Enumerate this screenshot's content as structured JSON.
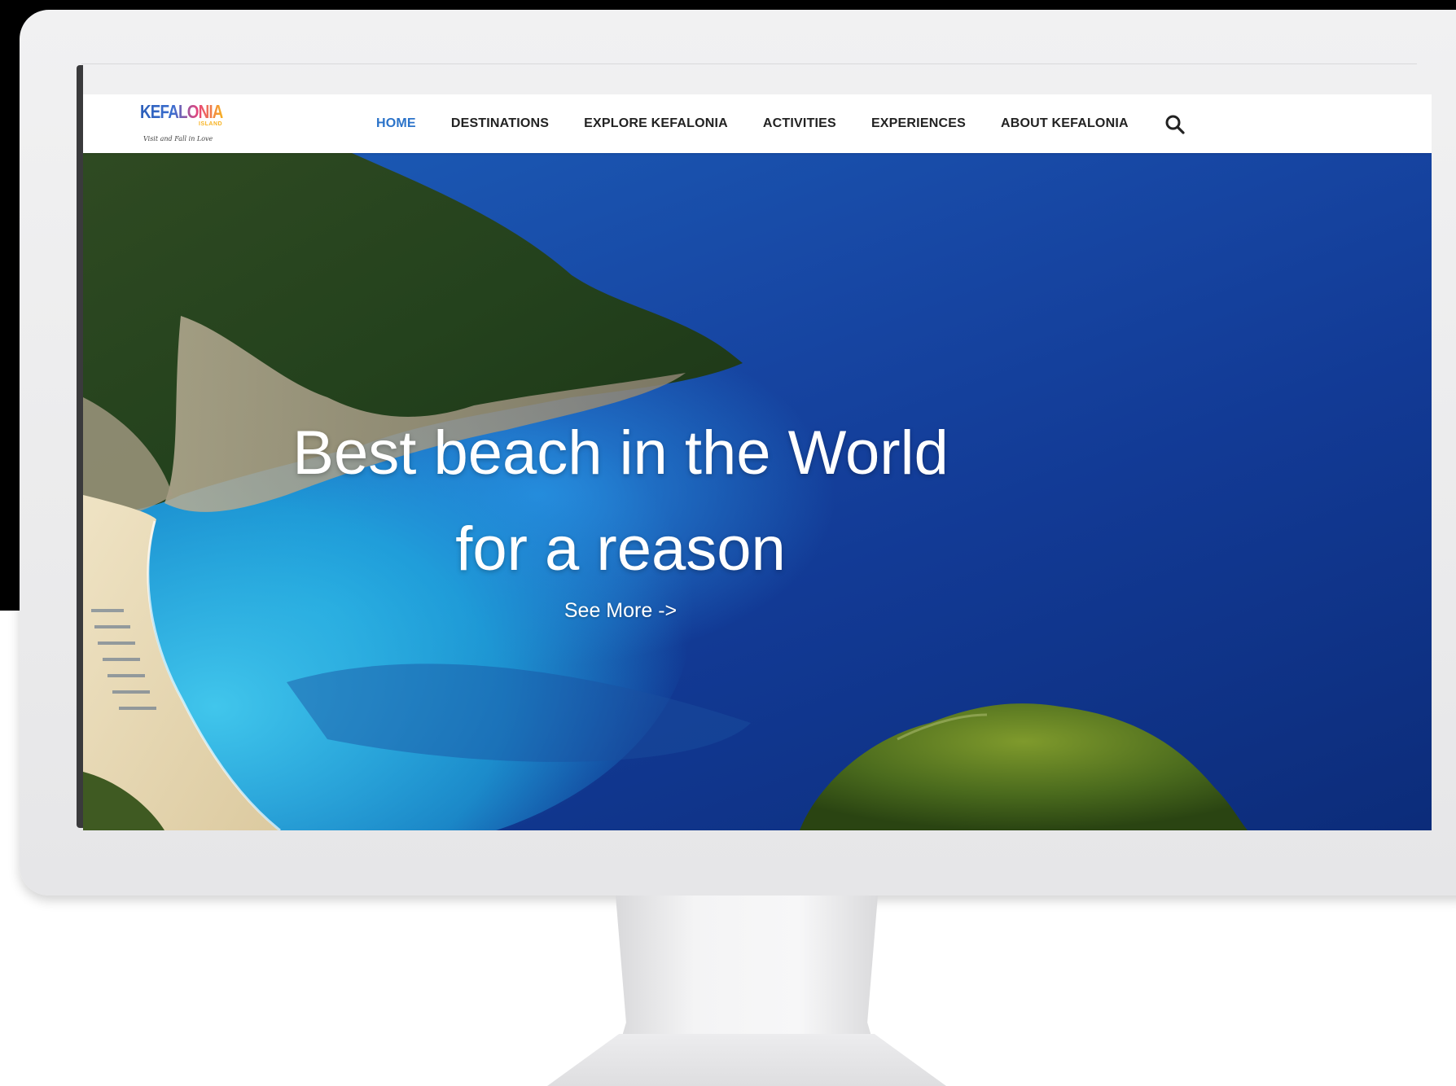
{
  "brand": {
    "name": "KEFALONIA",
    "sub": "ISLAND",
    "tagline": "Visit and Fall in Love"
  },
  "nav": {
    "items": [
      {
        "label": "HOME",
        "active": true
      },
      {
        "label": "DESTINATIONS",
        "active": false
      },
      {
        "label": "EXPLORE KEFALONIA",
        "active": false
      },
      {
        "label": "ACTIVITIES",
        "active": false
      },
      {
        "label": "EXPERIENCES",
        "active": false
      },
      {
        "label": "ABOUT KEFALONIA",
        "active": false
      }
    ],
    "search_icon": "search-icon"
  },
  "hero": {
    "title_line1": "Best beach in the World",
    "title_line2": "for a reason",
    "cta_label": "See More ->"
  },
  "colors": {
    "nav_active": "#2b73c9",
    "nav_text": "#222222",
    "sea_deep": "#0c2c7a",
    "sea_turquoise": "#26aae1"
  }
}
